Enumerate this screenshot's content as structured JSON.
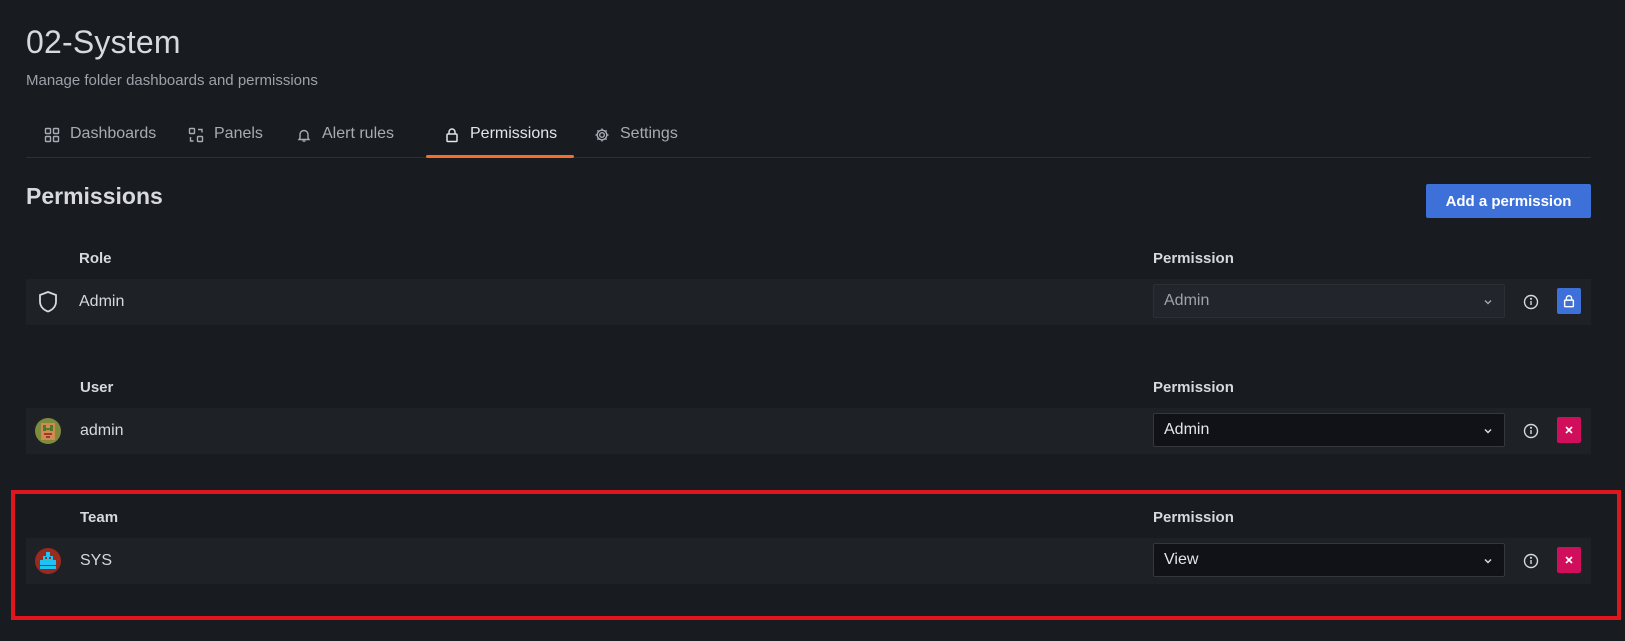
{
  "header": {
    "title": "02-System",
    "subtitle": "Manage folder dashboards and permissions"
  },
  "tabs": [
    {
      "label": "Dashboards",
      "icon": "apps-icon"
    },
    {
      "label": "Panels",
      "icon": "library-panel-icon"
    },
    {
      "label": "Alert rules",
      "icon": "bell-icon"
    },
    {
      "label": "Permissions",
      "icon": "lock-icon",
      "active": true
    },
    {
      "label": "Settings",
      "icon": "cog-icon"
    }
  ],
  "permissions": {
    "title": "Permissions",
    "add_button": "Add a permission",
    "groups": [
      {
        "header": "Role",
        "permission_header": "Permission",
        "entry": {
          "name": "Admin",
          "icon": "shield-icon",
          "permission": "Admin",
          "disabled": true,
          "action": "lock-icon"
        }
      },
      {
        "header": "User",
        "permission_header": "Permission",
        "entry": {
          "name": "admin",
          "icon": "user-avatar",
          "permission": "Admin",
          "disabled": false,
          "action": "times-icon"
        }
      },
      {
        "header": "Team",
        "permission_header": "Permission",
        "entry": {
          "name": "SYS",
          "icon": "team-avatar",
          "permission": "View",
          "disabled": false,
          "action": "times-icon"
        }
      }
    ]
  },
  "colors": {
    "background": "#181b1f",
    "accent_tab": "#f46f2a",
    "primary_button": "#3d71d9",
    "delete_button": "#d10e5c",
    "highlight_box": "#e0161f"
  }
}
